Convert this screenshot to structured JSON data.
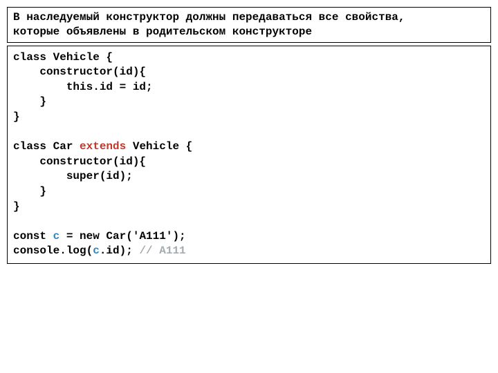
{
  "header": {
    "line1": "В наследуемый конструктор должны передаваться все свойства,",
    "line2": "которые объявлены в родительском конструкторе"
  },
  "code": {
    "l01": "class Vehicle {",
    "l02": "    constructor(id){",
    "l03": "        this.id = id;",
    "l04": "    }",
    "l05": "}",
    "l06": "",
    "l07a": "class Car ",
    "l07b": "extends",
    "l07c": " Vehicle {",
    "l08": "    constructor(id){",
    "l09": "        super(id);",
    "l10": "    }",
    "l11": "}",
    "l12": "",
    "l13a": "const ",
    "l13b": "c",
    "l13c": " = new Car('A111');",
    "l14a": "console.log(",
    "l14b": "c",
    "l14c": ".id); ",
    "l14d": "// A111"
  }
}
